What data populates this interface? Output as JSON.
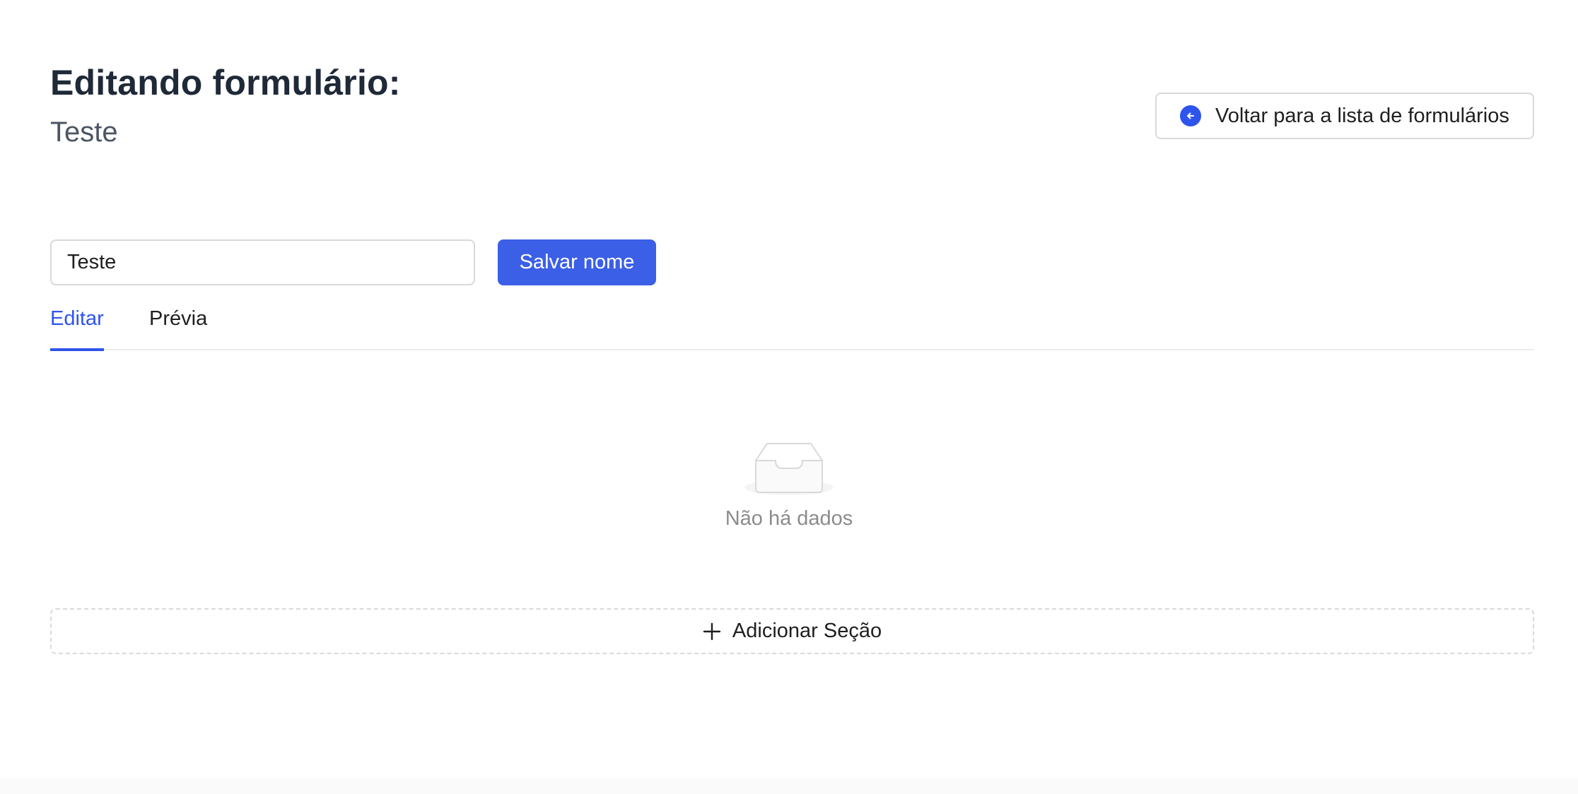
{
  "header": {
    "title": "Editando formulário:",
    "subtitle": "Teste",
    "back_button_label": "Voltar para a lista de formulários",
    "back_icon": "arrow-left-circle-icon"
  },
  "name_form": {
    "input_value": "Teste",
    "save_label": "Salvar nome"
  },
  "tabs": [
    {
      "label": "Editar",
      "active": true
    },
    {
      "label": "Prévia",
      "active": false
    }
  ],
  "empty_state": {
    "icon": "empty-inbox-icon",
    "text": "Não há dados"
  },
  "add_section": {
    "icon": "plus-icon",
    "label": "Adicionar Seção"
  },
  "colors": {
    "primary": "#3b5fe6",
    "title": "#1f2937",
    "muted": "#8c8c8c",
    "border": "#d9d9d9"
  }
}
